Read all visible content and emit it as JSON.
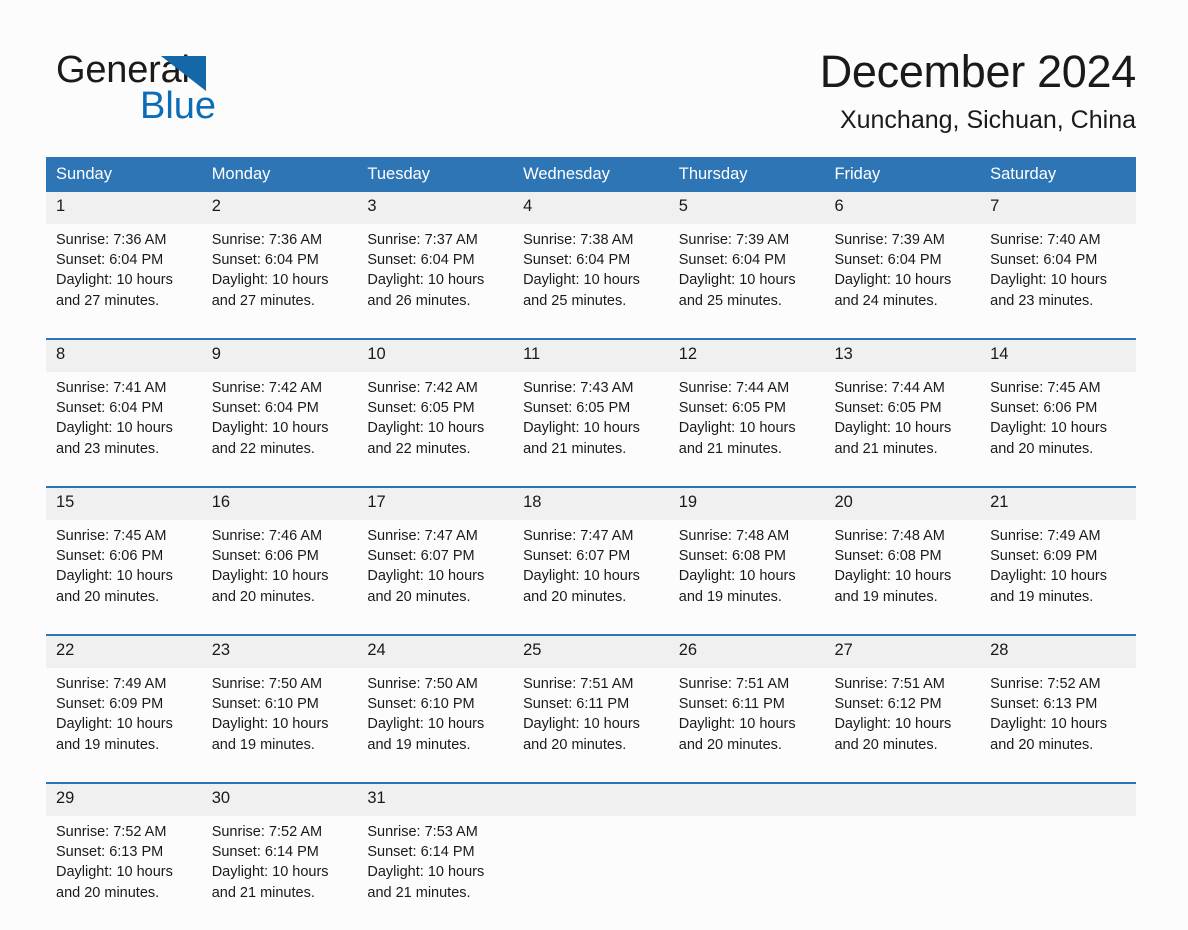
{
  "brand": {
    "word_one": "General",
    "word_two": "Blue",
    "logo_icon": "triangle-logo-icon",
    "accent_color": "#0b6cb7"
  },
  "header": {
    "title": "December 2024",
    "subtitle": "Xunchang, Sichuan, China"
  },
  "colors": {
    "header_bg": "#2e75b6",
    "header_text": "#ffffff",
    "daynum_bg": "#f0f0f0",
    "separator": "#2e75b6",
    "page_bg": "#fcfcfc",
    "text": "#1a1a1a"
  },
  "calendar": {
    "weekday_headers": [
      "Sunday",
      "Monday",
      "Tuesday",
      "Wednesday",
      "Thursday",
      "Friday",
      "Saturday"
    ],
    "weeks": [
      [
        {
          "day": "1",
          "sunrise": "Sunrise: 7:36 AM",
          "sunset": "Sunset: 6:04 PM",
          "daylight_line1": "Daylight: 10 hours",
          "daylight_line2": "and 27 minutes."
        },
        {
          "day": "2",
          "sunrise": "Sunrise: 7:36 AM",
          "sunset": "Sunset: 6:04 PM",
          "daylight_line1": "Daylight: 10 hours",
          "daylight_line2": "and 27 minutes."
        },
        {
          "day": "3",
          "sunrise": "Sunrise: 7:37 AM",
          "sunset": "Sunset: 6:04 PM",
          "daylight_line1": "Daylight: 10 hours",
          "daylight_line2": "and 26 minutes."
        },
        {
          "day": "4",
          "sunrise": "Sunrise: 7:38 AM",
          "sunset": "Sunset: 6:04 PM",
          "daylight_line1": "Daylight: 10 hours",
          "daylight_line2": "and 25 minutes."
        },
        {
          "day": "5",
          "sunrise": "Sunrise: 7:39 AM",
          "sunset": "Sunset: 6:04 PM",
          "daylight_line1": "Daylight: 10 hours",
          "daylight_line2": "and 25 minutes."
        },
        {
          "day": "6",
          "sunrise": "Sunrise: 7:39 AM",
          "sunset": "Sunset: 6:04 PM",
          "daylight_line1": "Daylight: 10 hours",
          "daylight_line2": "and 24 minutes."
        },
        {
          "day": "7",
          "sunrise": "Sunrise: 7:40 AM",
          "sunset": "Sunset: 6:04 PM",
          "daylight_line1": "Daylight: 10 hours",
          "daylight_line2": "and 23 minutes."
        }
      ],
      [
        {
          "day": "8",
          "sunrise": "Sunrise: 7:41 AM",
          "sunset": "Sunset: 6:04 PM",
          "daylight_line1": "Daylight: 10 hours",
          "daylight_line2": "and 23 minutes."
        },
        {
          "day": "9",
          "sunrise": "Sunrise: 7:42 AM",
          "sunset": "Sunset: 6:04 PM",
          "daylight_line1": "Daylight: 10 hours",
          "daylight_line2": "and 22 minutes."
        },
        {
          "day": "10",
          "sunrise": "Sunrise: 7:42 AM",
          "sunset": "Sunset: 6:05 PM",
          "daylight_line1": "Daylight: 10 hours",
          "daylight_line2": "and 22 minutes."
        },
        {
          "day": "11",
          "sunrise": "Sunrise: 7:43 AM",
          "sunset": "Sunset: 6:05 PM",
          "daylight_line1": "Daylight: 10 hours",
          "daylight_line2": "and 21 minutes."
        },
        {
          "day": "12",
          "sunrise": "Sunrise: 7:44 AM",
          "sunset": "Sunset: 6:05 PM",
          "daylight_line1": "Daylight: 10 hours",
          "daylight_line2": "and 21 minutes."
        },
        {
          "day": "13",
          "sunrise": "Sunrise: 7:44 AM",
          "sunset": "Sunset: 6:05 PM",
          "daylight_line1": "Daylight: 10 hours",
          "daylight_line2": "and 21 minutes."
        },
        {
          "day": "14",
          "sunrise": "Sunrise: 7:45 AM",
          "sunset": "Sunset: 6:06 PM",
          "daylight_line1": "Daylight: 10 hours",
          "daylight_line2": "and 20 minutes."
        }
      ],
      [
        {
          "day": "15",
          "sunrise": "Sunrise: 7:45 AM",
          "sunset": "Sunset: 6:06 PM",
          "daylight_line1": "Daylight: 10 hours",
          "daylight_line2": "and 20 minutes."
        },
        {
          "day": "16",
          "sunrise": "Sunrise: 7:46 AM",
          "sunset": "Sunset: 6:06 PM",
          "daylight_line1": "Daylight: 10 hours",
          "daylight_line2": "and 20 minutes."
        },
        {
          "day": "17",
          "sunrise": "Sunrise: 7:47 AM",
          "sunset": "Sunset: 6:07 PM",
          "daylight_line1": "Daylight: 10 hours",
          "daylight_line2": "and 20 minutes."
        },
        {
          "day": "18",
          "sunrise": "Sunrise: 7:47 AM",
          "sunset": "Sunset: 6:07 PM",
          "daylight_line1": "Daylight: 10 hours",
          "daylight_line2": "and 20 minutes."
        },
        {
          "day": "19",
          "sunrise": "Sunrise: 7:48 AM",
          "sunset": "Sunset: 6:08 PM",
          "daylight_line1": "Daylight: 10 hours",
          "daylight_line2": "and 19 minutes."
        },
        {
          "day": "20",
          "sunrise": "Sunrise: 7:48 AM",
          "sunset": "Sunset: 6:08 PM",
          "daylight_line1": "Daylight: 10 hours",
          "daylight_line2": "and 19 minutes."
        },
        {
          "day": "21",
          "sunrise": "Sunrise: 7:49 AM",
          "sunset": "Sunset: 6:09 PM",
          "daylight_line1": "Daylight: 10 hours",
          "daylight_line2": "and 19 minutes."
        }
      ],
      [
        {
          "day": "22",
          "sunrise": "Sunrise: 7:49 AM",
          "sunset": "Sunset: 6:09 PM",
          "daylight_line1": "Daylight: 10 hours",
          "daylight_line2": "and 19 minutes."
        },
        {
          "day": "23",
          "sunrise": "Sunrise: 7:50 AM",
          "sunset": "Sunset: 6:10 PM",
          "daylight_line1": "Daylight: 10 hours",
          "daylight_line2": "and 19 minutes."
        },
        {
          "day": "24",
          "sunrise": "Sunrise: 7:50 AM",
          "sunset": "Sunset: 6:10 PM",
          "daylight_line1": "Daylight: 10 hours",
          "daylight_line2": "and 19 minutes."
        },
        {
          "day": "25",
          "sunrise": "Sunrise: 7:51 AM",
          "sunset": "Sunset: 6:11 PM",
          "daylight_line1": "Daylight: 10 hours",
          "daylight_line2": "and 20 minutes."
        },
        {
          "day": "26",
          "sunrise": "Sunrise: 7:51 AM",
          "sunset": "Sunset: 6:11 PM",
          "daylight_line1": "Daylight: 10 hours",
          "daylight_line2": "and 20 minutes."
        },
        {
          "day": "27",
          "sunrise": "Sunrise: 7:51 AM",
          "sunset": "Sunset: 6:12 PM",
          "daylight_line1": "Daylight: 10 hours",
          "daylight_line2": "and 20 minutes."
        },
        {
          "day": "28",
          "sunrise": "Sunrise: 7:52 AM",
          "sunset": "Sunset: 6:13 PM",
          "daylight_line1": "Daylight: 10 hours",
          "daylight_line2": "and 20 minutes."
        }
      ],
      [
        {
          "day": "29",
          "sunrise": "Sunrise: 7:52 AM",
          "sunset": "Sunset: 6:13 PM",
          "daylight_line1": "Daylight: 10 hours",
          "daylight_line2": "and 20 minutes."
        },
        {
          "day": "30",
          "sunrise": "Sunrise: 7:52 AM",
          "sunset": "Sunset: 6:14 PM",
          "daylight_line1": "Daylight: 10 hours",
          "daylight_line2": "and 21 minutes."
        },
        {
          "day": "31",
          "sunrise": "Sunrise: 7:53 AM",
          "sunset": "Sunset: 6:14 PM",
          "daylight_line1": "Daylight: 10 hours",
          "daylight_line2": "and 21 minutes."
        },
        {
          "day": "",
          "sunrise": "",
          "sunset": "",
          "daylight_line1": "",
          "daylight_line2": ""
        },
        {
          "day": "",
          "sunrise": "",
          "sunset": "",
          "daylight_line1": "",
          "daylight_line2": ""
        },
        {
          "day": "",
          "sunrise": "",
          "sunset": "",
          "daylight_line1": "",
          "daylight_line2": ""
        },
        {
          "day": "",
          "sunrise": "",
          "sunset": "",
          "daylight_line1": "",
          "daylight_line2": ""
        }
      ]
    ]
  }
}
